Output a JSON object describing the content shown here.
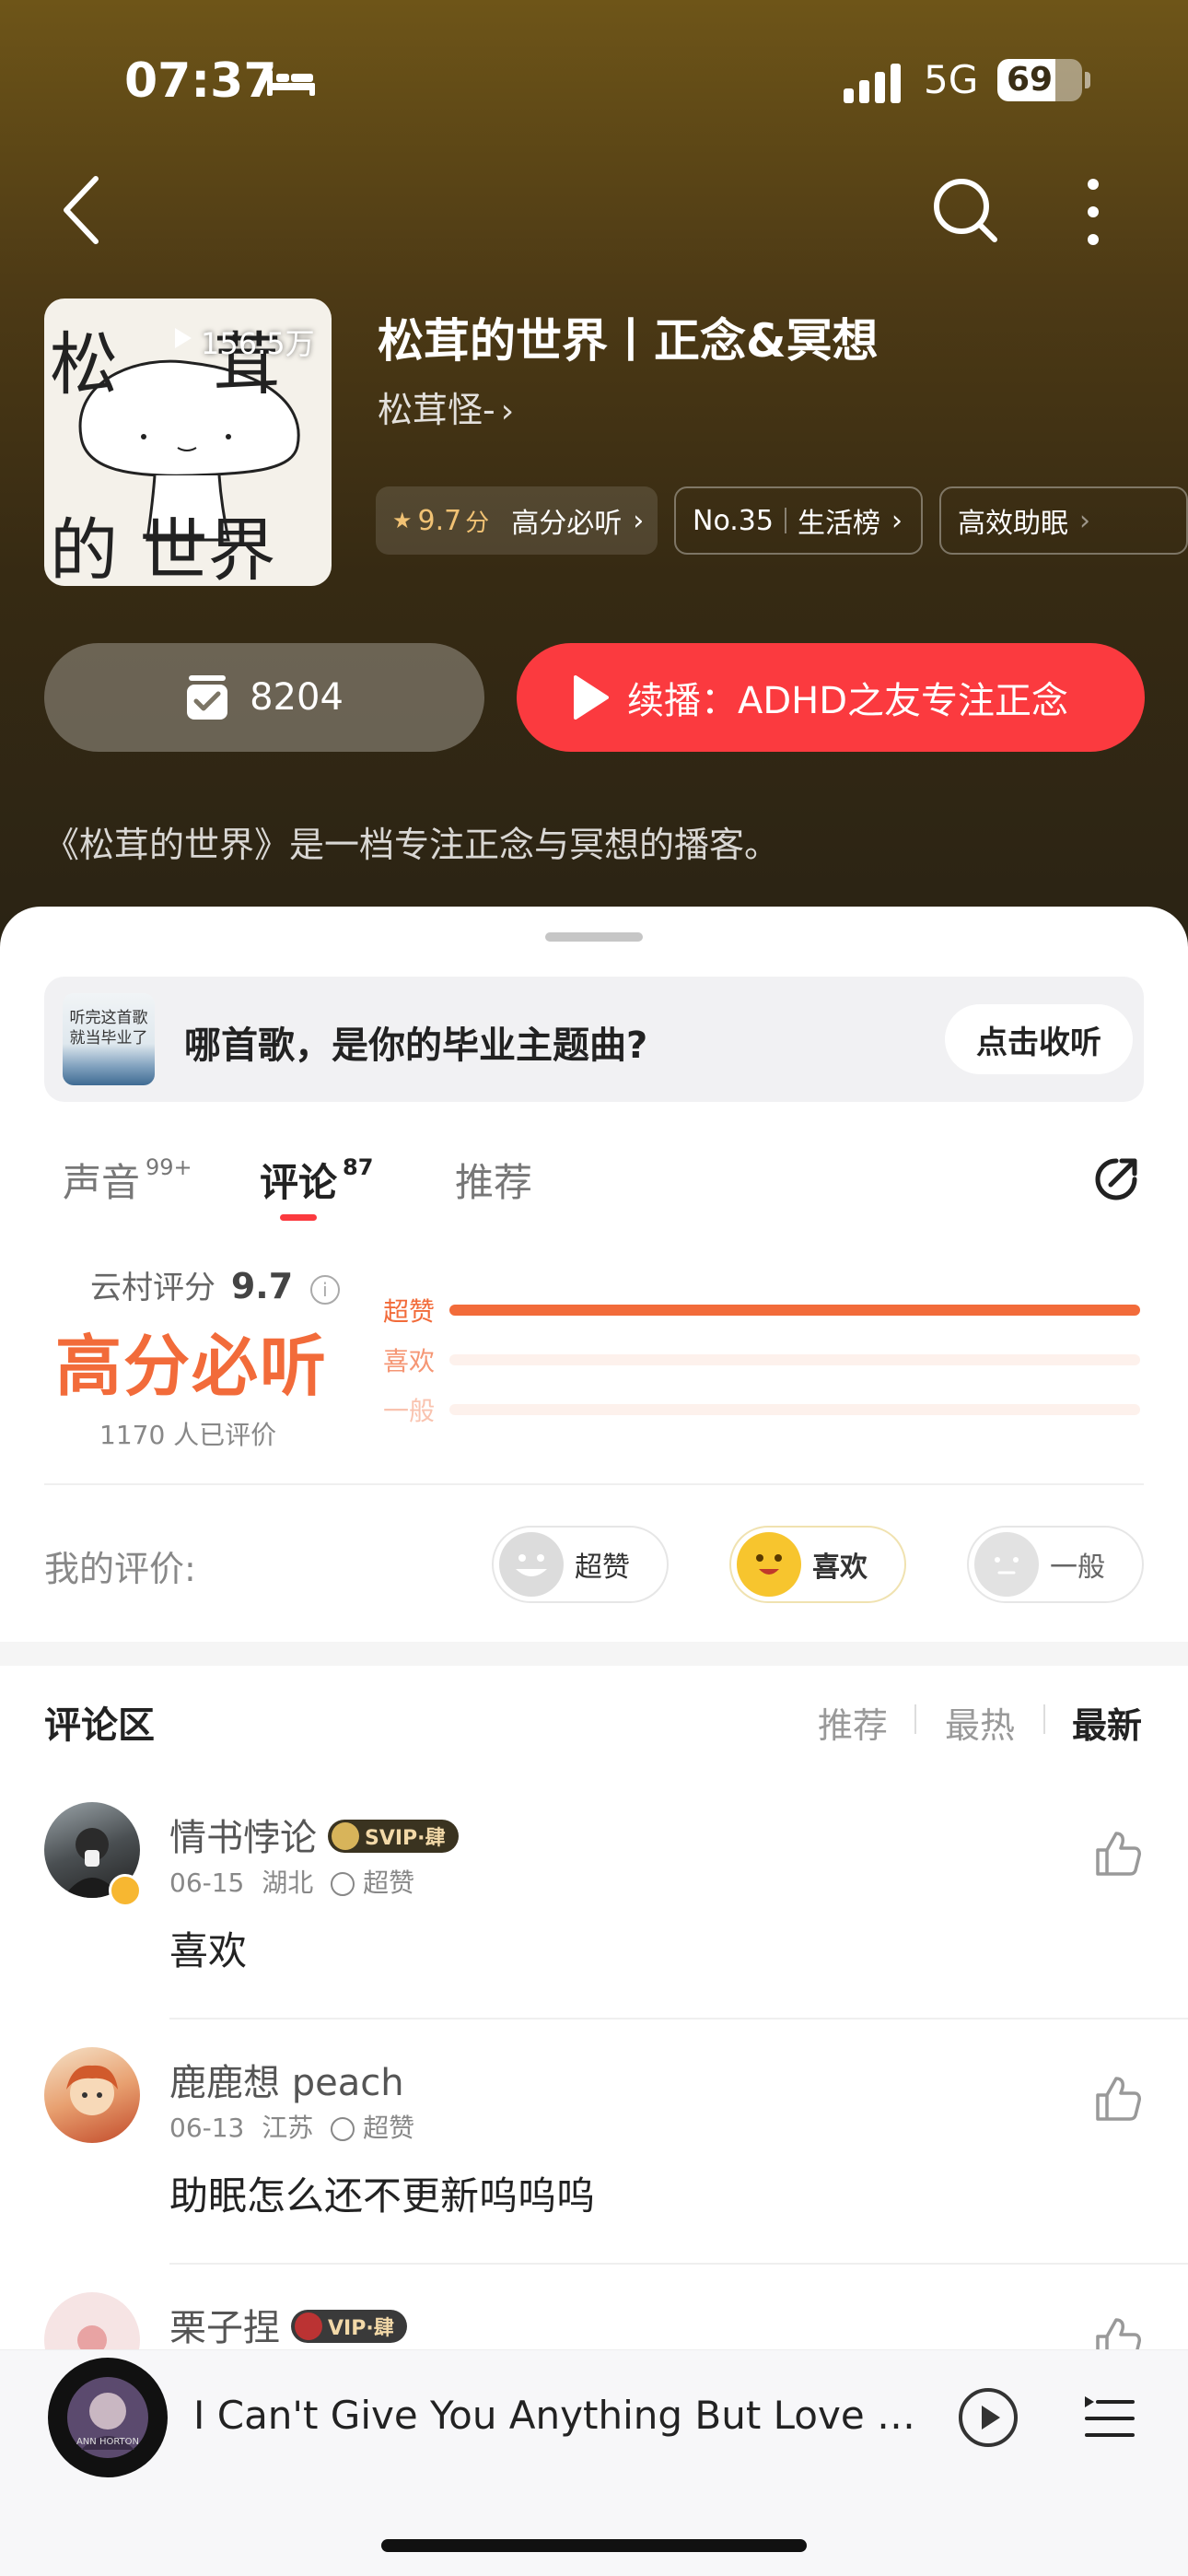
{
  "status_bar": {
    "time": "07:37",
    "network": "5G",
    "battery_level": 69,
    "battery_text": "69"
  },
  "podcast": {
    "cover_text_top": "松 茸",
    "cover_text_bottom": "的 世界",
    "plays": "156.5万",
    "title": "松茸的世界丨正念&冥想",
    "author": "松茸怪-",
    "author_chevron": "›",
    "tags": {
      "rating_star": "★",
      "rating_value": "9.7",
      "rating_unit": "分",
      "rating_label": "高分必听",
      "rank_no": "No.35",
      "rank_label": "生活榜",
      "extra_label": "高效助眠",
      "chevron": "›"
    },
    "collect_count": "8204",
    "continue_label": "续播：",
    "continue_title": "ADHD之友专注正念",
    "description": "《松茸的世界》是一档专注正念与冥想的播客。"
  },
  "banner": {
    "thumb_text_1": "听完这首歌",
    "thumb_text_2": "就当毕业了",
    "text": "哪首歌，是你的毕业主题曲?",
    "button": "点击收听"
  },
  "tabs": [
    {
      "label": "声音",
      "count": "99+"
    },
    {
      "label": "评论",
      "count": "87"
    },
    {
      "label": "推荐",
      "count": ""
    }
  ],
  "rating": {
    "label": "云村评分",
    "score": "9.7",
    "verdict": "高分必听",
    "count_text": "1170 人已评价",
    "bars": [
      {
        "name": "超赞",
        "value": 1.0
      },
      {
        "name": "喜欢",
        "value": 0.0
      },
      {
        "name": "一般",
        "value": 0.0
      }
    ]
  },
  "my_rating": {
    "label": "我的评价:",
    "options": [
      "超赞",
      "喜欢",
      "一般"
    ],
    "selected": "喜欢"
  },
  "comments_section": {
    "title": "评论区",
    "sort_options": [
      "推荐",
      "最热",
      "最新"
    ],
    "active_sort": "最新"
  },
  "comments": [
    {
      "name": "情书悖论",
      "badge": "SVIP·肆",
      "date": "06-15",
      "location": "湖北",
      "rating": "超赞",
      "text": "喜欢"
    },
    {
      "name": "鹿鹿想 peach",
      "badge": "",
      "date": "06-13",
      "location": "江苏",
      "rating": "超赞",
      "text": "助眠怎么还不更新呜呜呜"
    },
    {
      "name": "栗子捏",
      "badge": "VIP·肆",
      "date": "",
      "location": "",
      "rating": "",
      "text": ""
    }
  ],
  "player": {
    "song": "I Can't Give You Anything But Love Ba...",
    "disc_text": "ANN HORTON"
  }
}
